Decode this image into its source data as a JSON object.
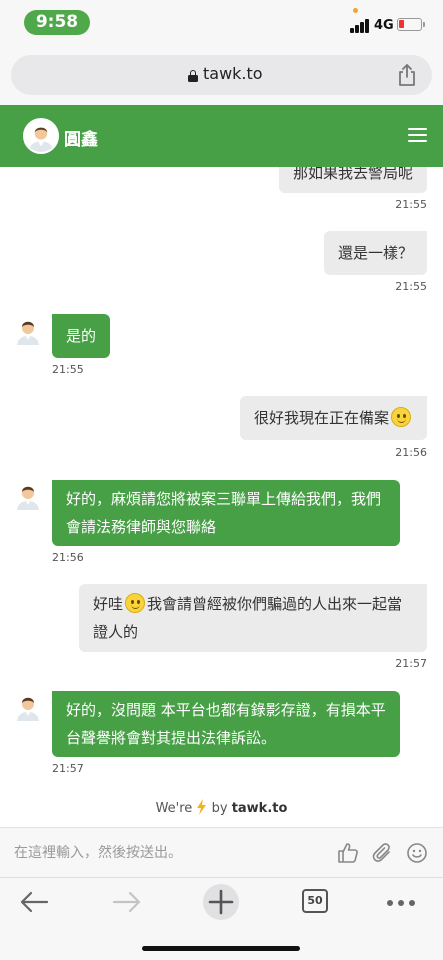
{
  "status_bar": {
    "time": "9:58",
    "network": "4G"
  },
  "browser": {
    "url": "tawk.to"
  },
  "chat_header": {
    "agent_name": "圓鑫"
  },
  "messages": [
    {
      "from": "visitor",
      "text": "那如果我去警局呢",
      "time": "21:55"
    },
    {
      "from": "visitor",
      "text": "還是一樣？",
      "time": "21:55"
    },
    {
      "from": "agent",
      "text": "是的",
      "time": "21:55"
    },
    {
      "from": "visitor",
      "text": "很好我現在正在備案",
      "time": "21:56"
    },
    {
      "from": "agent",
      "lines": [
        "好的，麻煩請您將被案三聯單上傳給我們，我們",
        "會請法務律師與您聯絡"
      ],
      "time": "21:56"
    },
    {
      "from": "visitor",
      "lines": [
        "好哇",
        "我會請曾經被你們騙過的人出來一起當",
        "證人的"
      ],
      "time": "21:57"
    },
    {
      "from": "agent",
      "lines": [
        "好的，沒問題 本平台也都有錄影存證，有損本平",
        "台聲譽將會對其提出法律訴訟。"
      ],
      "time": "21:57"
    }
  ],
  "powered_by": {
    "prefix": "We're",
    "middle": "by",
    "brand": "tawk.to"
  },
  "composer": {
    "placeholder": "在這裡輸入，然後按送出。"
  },
  "toolbar": {
    "tab_count": "50"
  },
  "colors": {
    "brand_green": "#47a046",
    "status_pill": "#4fa84a",
    "bubble_grey": "#ebebeb"
  },
  "icons": [
    "lock-icon",
    "share-icon",
    "menu-icon",
    "thumbs-up-icon",
    "paperclip-icon",
    "smiley-icon",
    "back-arrow-icon",
    "forward-arrow-icon",
    "new-tab-icon",
    "more-icon"
  ]
}
